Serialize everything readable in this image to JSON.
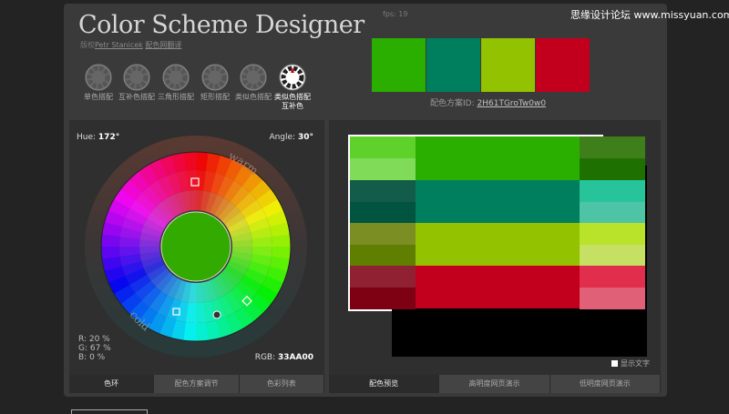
{
  "app": {
    "title": "Color Scheme Designer",
    "credit_prefix": "版权",
    "credit_author": "Petr Stanicek",
    "credit_link": "配色网翻译",
    "fps": "fps: 19",
    "watermark": "思缘设计论坛 www.missyuan.com"
  },
  "modes": [
    {
      "label": "单色搭配",
      "active": false
    },
    {
      "label": "互补色搭配",
      "active": false
    },
    {
      "label": "三角形搭配",
      "active": false
    },
    {
      "label": "矩形搭配",
      "active": false
    },
    {
      "label": "类似色搭配",
      "active": false
    },
    {
      "label": "类似色搭配互补色",
      "active": true
    }
  ],
  "scheme": {
    "swatches": [
      "#2aae00",
      "#007f5e",
      "#93c200",
      "#c2001d"
    ],
    "id_label": "配色方案ID:",
    "id_value": "2H61TGroTw0w0"
  },
  "wheel": {
    "hue_label": "Hue:",
    "hue_value": "172°",
    "angle_label": "Angle:",
    "angle_value": "30°",
    "warm": "warm",
    "cold": "cold",
    "center_color": "#33aa00",
    "r": "R: 20 %",
    "g": "G: 67 %",
    "b": "B:   0 %",
    "rgb_label": "RGB:",
    "rgb_value": "33AA00"
  },
  "left_tabs": [
    {
      "label": "色环",
      "active": true
    },
    {
      "label": "配色方案调节",
      "active": false
    },
    {
      "label": "色彩列表",
      "active": false
    }
  ],
  "right_tabs": [
    {
      "label": "配色预览",
      "active": true
    },
    {
      "label": "高明度网页演示",
      "active": false
    },
    {
      "label": "低明度网页演示",
      "active": false
    }
  ],
  "preview": {
    "rows": [
      {
        "light": [
          "#5ed12a",
          "#80db58"
        ],
        "main": "#2aae00",
        "dark": [
          "#3e7f1c",
          "#1e7100"
        ]
      },
      {
        "light": [
          "#125c49",
          "#005440"
        ],
        "main": "#007f5e",
        "dark": [
          "#27c49b",
          "#4dc4a5"
        ]
      },
      {
        "light": [
          "#7a8e23",
          "#607e00"
        ],
        "main": "#93c200",
        "dark": [
          "#b9e22a",
          "#c5e062"
        ]
      },
      {
        "light": [
          "#8f2133",
          "#7e0013"
        ],
        "main": "#c2001d",
        "dark": [
          "#e02e4c",
          "#e06077"
        ]
      }
    ]
  },
  "show_text": "显示文字"
}
